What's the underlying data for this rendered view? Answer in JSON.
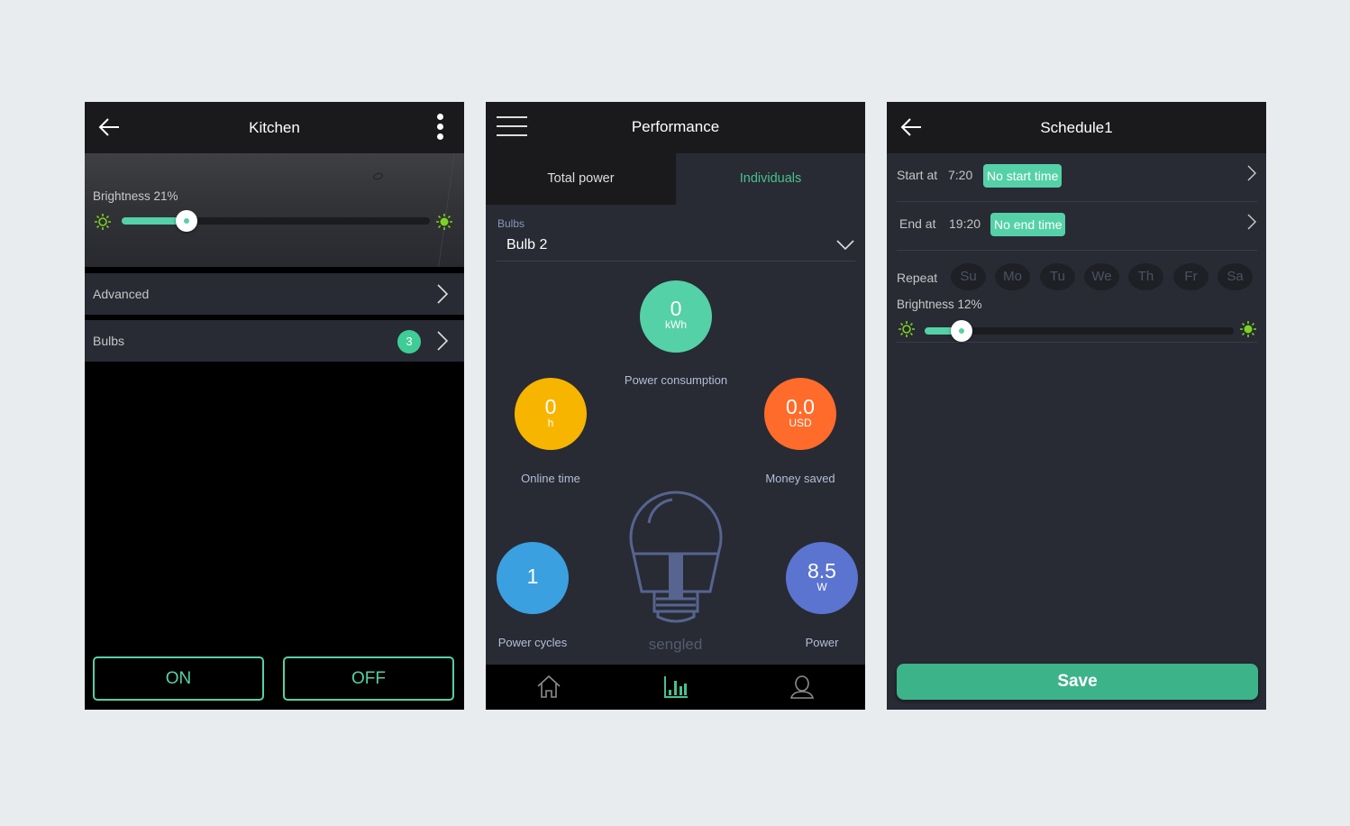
{
  "kitchen_screen": {
    "title": "Kitchen",
    "brightness_label": "Brightness 21%",
    "brightness_percent": 21,
    "menu": [
      {
        "label": "Advanced"
      },
      {
        "label": "Bulbs",
        "badge": "3"
      }
    ],
    "on_label": "ON",
    "off_label": "OFF",
    "icons": {
      "back": "arrow-left-icon",
      "more": "more-vertical-icon",
      "sun_low": "sun-outline-icon",
      "sun_high": "sun-filled-icon",
      "chevron": "chevron-right-icon"
    }
  },
  "performance_screen": {
    "title": "Performance",
    "tabs": [
      {
        "label": "Total power",
        "active": false
      },
      {
        "label": "Individuals",
        "active": true
      }
    ],
    "bulb_select": {
      "label": "Bulbs",
      "value": "Bulb 2"
    },
    "metrics": [
      {
        "id": "power-consumption",
        "value": "0",
        "unit": "kWh",
        "label": "Power consumption",
        "color": "#55d1a7"
      },
      {
        "id": "online-time",
        "value": "0",
        "unit": "h",
        "label": "Online time",
        "color": "#f7b500"
      },
      {
        "id": "money-saved",
        "value": "0.0",
        "unit": "USD",
        "label": "Money saved",
        "color": "#ff6b2b"
      },
      {
        "id": "power-cycles",
        "value": "1",
        "unit": "",
        "label": "Power cycles",
        "color": "#3aa0e0"
      },
      {
        "id": "power",
        "value": "8.5",
        "unit": "W",
        "label": "Power",
        "color": "#5b74d0"
      }
    ],
    "brand": "sengled",
    "nav": [
      {
        "icon": "home-icon",
        "active": false
      },
      {
        "icon": "bar-chart-icon",
        "active": true
      },
      {
        "icon": "user-icon",
        "active": false
      }
    ],
    "colors": {
      "accent": "#48c08f"
    }
  },
  "schedule_screen": {
    "title": "Schedule1",
    "start": {
      "label": "Start at",
      "time": "7:20",
      "pill": "No start time"
    },
    "end": {
      "label": "End at",
      "time": "19:20",
      "pill": "No end time"
    },
    "repeat_label": "Repeat",
    "days": [
      "Su",
      "Mo",
      "Tu",
      "We",
      "Th",
      "Fr",
      "Sa"
    ],
    "brightness_label": "Brightness 12%",
    "brightness_percent": 12,
    "save_label": "Save"
  }
}
